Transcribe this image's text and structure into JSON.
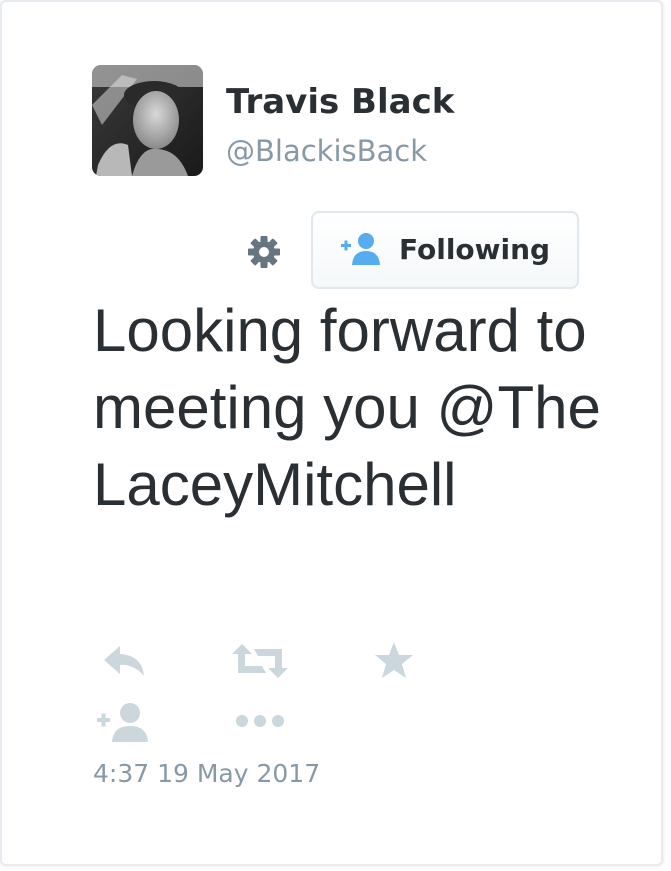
{
  "tweet": {
    "author": {
      "display_name": "Travis Black",
      "handle": "@BlackisBack"
    },
    "follow_button": {
      "label": "Following"
    },
    "text": "Looking forward to meeting you @TheLaceyMitchell",
    "timestamp": "4:37 19 May 2017"
  },
  "icons": {
    "settings": "gear-icon",
    "follow": "add-user-icon",
    "reply": "reply-icon",
    "retweet": "retweet-icon",
    "favorite": "star-icon",
    "follow_action": "add-user-icon",
    "more": "more-dots-icon"
  },
  "colors": {
    "text": "#292f33",
    "muted": "#8899a6",
    "accent": "#55acee",
    "action_icons": "#ccd6dd"
  }
}
